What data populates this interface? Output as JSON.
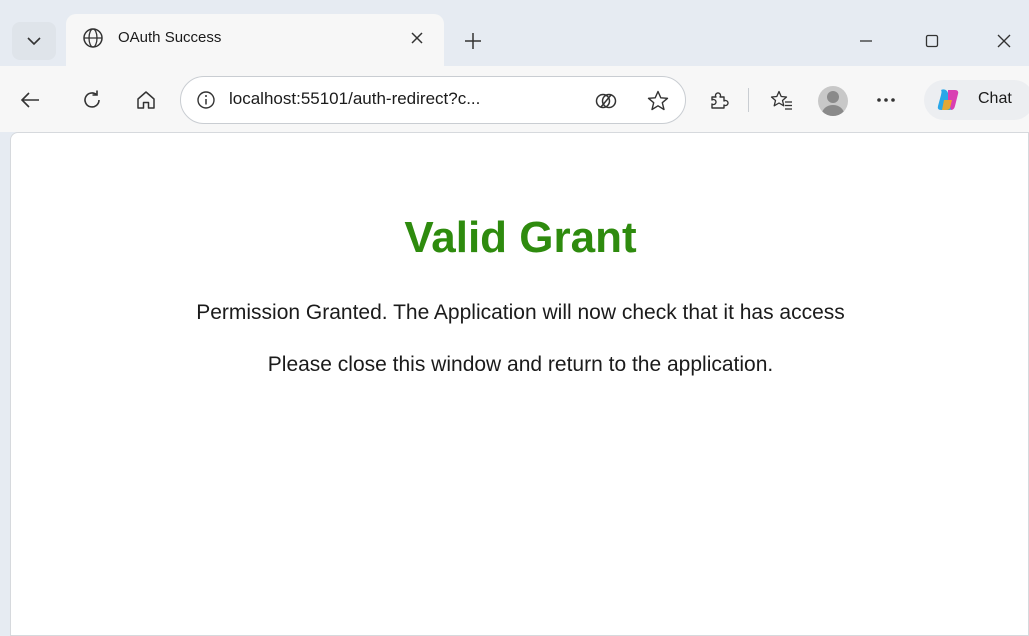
{
  "tab": {
    "title": "OAuth Success"
  },
  "address_bar": {
    "url": "localhost:55101/auth-redirect?c..."
  },
  "toolbar": {
    "chat_label": "Chat"
  },
  "page": {
    "heading": "Valid Grant",
    "message": "Permission Granted. The Application will now check that it has access",
    "instruction": "Please close this window and return to the application."
  },
  "colors": {
    "heading": "#2e8b0e",
    "toolbar_bg": "#f7f7f7",
    "tabstrip_bg": "#e6ebf2"
  },
  "icons": [
    "tab-search-icon",
    "globe-icon",
    "close-icon",
    "plus-icon",
    "minimize-icon",
    "maximize-icon",
    "window-close-icon",
    "back-icon",
    "refresh-icon",
    "home-icon",
    "info-icon",
    "copilot-compose-icon",
    "favorite-star-icon",
    "extensions-icon",
    "favorites-icon",
    "profile-avatar",
    "more-icon",
    "copilot-icon"
  ]
}
